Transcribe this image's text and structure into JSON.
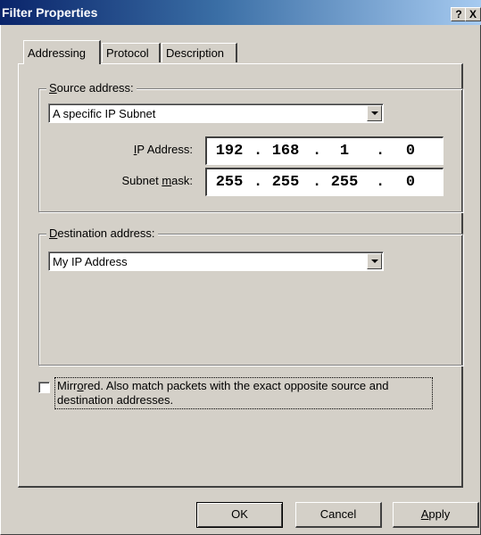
{
  "window": {
    "title": "Filter Properties",
    "help_button": "?",
    "close_button": "X"
  },
  "tabs": [
    {
      "label": "Addressing",
      "active": true
    },
    {
      "label": "Protocol",
      "active": false
    },
    {
      "label": "Description",
      "active": false
    }
  ],
  "source": {
    "legend_prefix": "",
    "legend_accel": "S",
    "legend_rest": "ource address:",
    "selected": "A specific IP Subnet",
    "ip_label_accel": "I",
    "ip_label_rest": "P Address:",
    "ip_octets": [
      "192",
      "168",
      "1",
      "0"
    ],
    "mask_label_prefix": "Subnet ",
    "mask_label_accel": "m",
    "mask_label_rest": "ask:",
    "mask_octets": [
      "255",
      "255",
      "255",
      "0"
    ]
  },
  "destination": {
    "legend_accel": "D",
    "legend_rest": "estination address:",
    "selected": "My IP Address"
  },
  "mirrored": {
    "checked": false,
    "text_prefix": "Mirr",
    "text_accel": "o",
    "text_rest": "red. Also match packets with the exact opposite source and",
    "text_line2": "destination addresses."
  },
  "buttons": {
    "ok": "OK",
    "cancel": "Cancel",
    "apply_accel": "A",
    "apply_rest": "pply"
  },
  "colors": {
    "titlebar_start": "#0a246a",
    "titlebar_end": "#a6caf0",
    "face": "#d4d0c8"
  }
}
